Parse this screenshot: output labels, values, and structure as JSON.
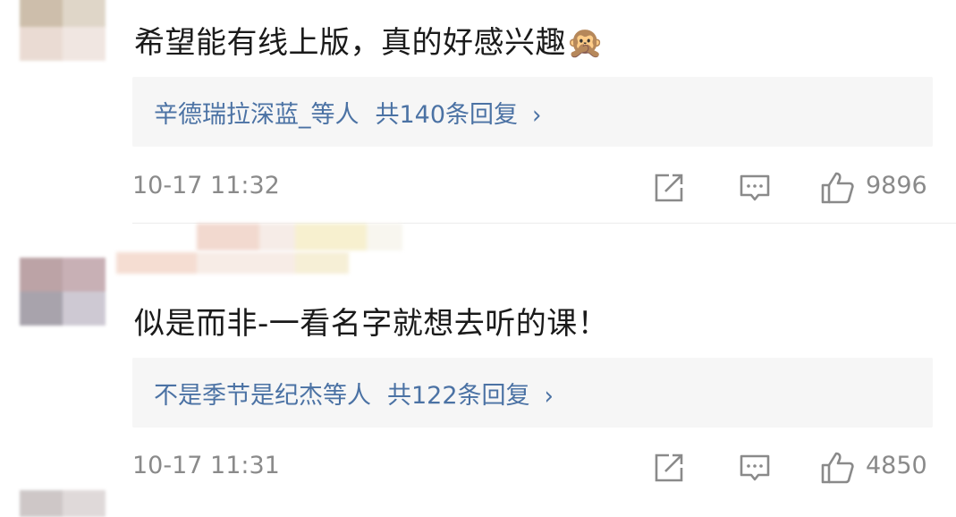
{
  "comments": [
    {
      "text": "希望能有线上版，真的好感兴趣🙊",
      "reply_summary": "辛德瑞拉深蓝_等人",
      "reply_count": "共140条回复",
      "reply_chevron": "›",
      "timestamp": "10-17 11:32",
      "likes": "9896",
      "avatar_colors": [
        "#c8b8a2",
        "#d6cdbd",
        "#e8d8cf",
        "#efe4de"
      ]
    },
    {
      "text": "似是而非-一看名字就想去听的课！",
      "reply_summary": "不是季节是纪杰等人",
      "reply_count": "共122条回复",
      "reply_chevron": "›",
      "timestamp": "10-17 11:31",
      "likes": "4850",
      "avatar_colors": [
        "#b59a9d",
        "#c3a8ae",
        "#9f9aa4",
        "#c9c4cf"
      ]
    }
  ],
  "icon_color": "#8a8a8a",
  "link_color": "#4b72a4"
}
